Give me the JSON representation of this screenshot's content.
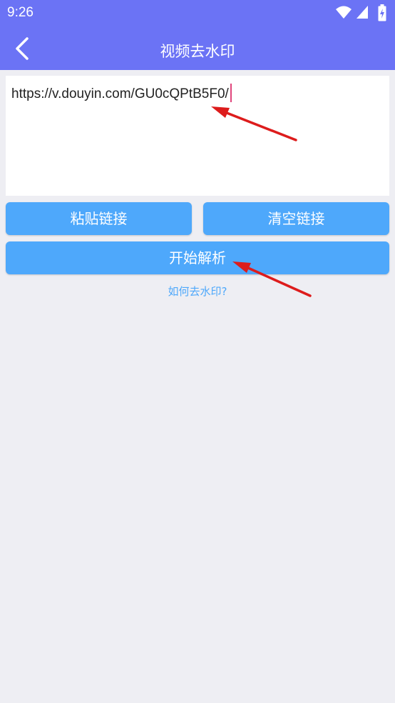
{
  "status_bar": {
    "time": "9:26",
    "icons": [
      "wifi-icon",
      "signal-icon",
      "battery-charging-icon"
    ]
  },
  "header": {
    "title": "视频去水印",
    "back_icon": "chevron-left-icon"
  },
  "url_input": {
    "value": "https://v.douyin.com/GU0cQPtB5F0/"
  },
  "buttons": {
    "paste": "粘贴链接",
    "clear": "清空链接",
    "parse": "开始解析"
  },
  "help_link": "如何去水印?",
  "colors": {
    "header": "#6b73f5",
    "button": "#4ea8fb",
    "background": "#eeeef3",
    "caret": "#e0457b",
    "annotation_arrow": "#dd1c1c"
  }
}
